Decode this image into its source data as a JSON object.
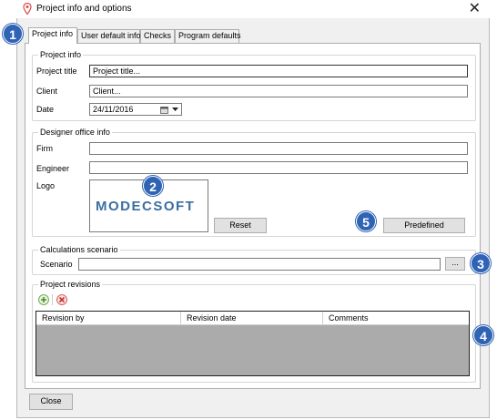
{
  "window": {
    "title": "Project info and options",
    "close_glyph": "✕"
  },
  "tabs": [
    {
      "label": "Project info"
    },
    {
      "label": "User default info"
    },
    {
      "label": "Checks"
    },
    {
      "label": "Program defaults"
    }
  ],
  "project_info": {
    "group_label": "Project info",
    "title_label": "Project title",
    "title_value": "Project title...",
    "client_label": "Client",
    "client_value": "Client...",
    "date_label": "Date",
    "date_value": "24/11/2016"
  },
  "designer": {
    "group_label": "Designer office info",
    "firm_label": "Firm",
    "firm_value": "",
    "engineer_label": "Engineer",
    "engineer_value": "",
    "logo_label": "Logo",
    "logo_text": "MODECSOFT",
    "reset_label": "Reset",
    "predefined_label": "Predefined"
  },
  "scenario": {
    "group_label": "Calculations scenario",
    "label": "Scenario",
    "value": "",
    "browse_label": "..."
  },
  "revisions": {
    "group_label": "Project revisions",
    "columns": [
      "Revision by",
      "Revision date",
      "Comments"
    ],
    "add_icon": "add-icon",
    "remove_icon": "remove-icon"
  },
  "footer": {
    "close_label": "Close"
  },
  "badges": [
    "1",
    "2",
    "3",
    "4",
    "5"
  ],
  "colors": {
    "badge": "#2f63b4",
    "logo": "#3b6ea0",
    "grid_empty": "#ababab"
  }
}
